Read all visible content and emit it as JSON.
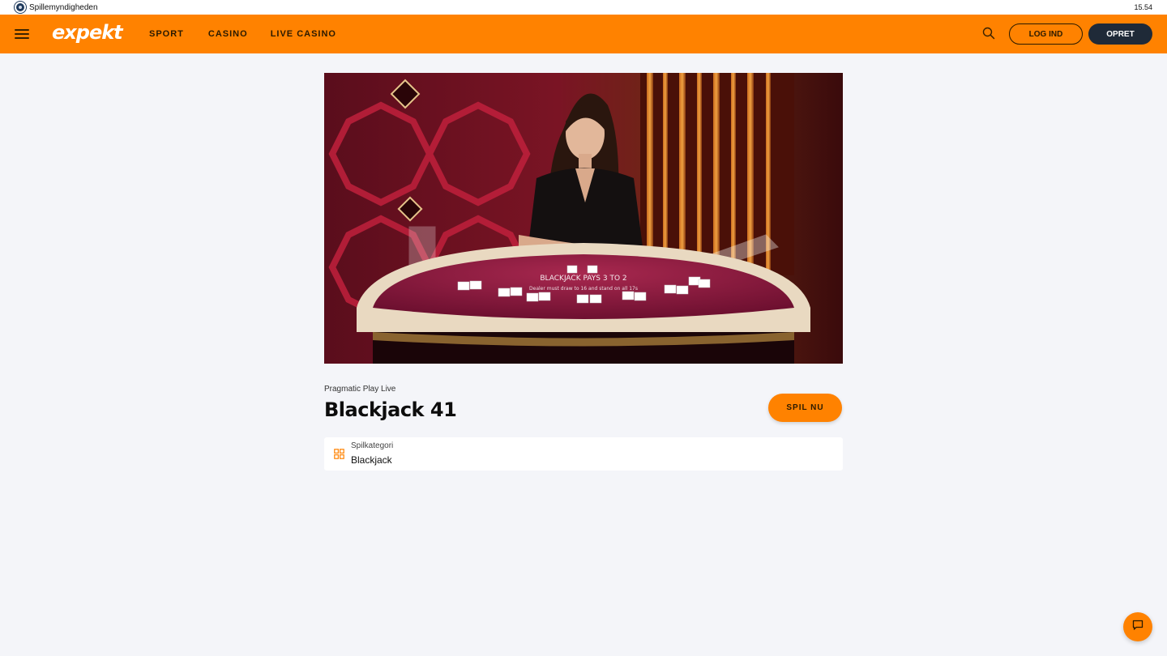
{
  "regulator": {
    "name": "Spillemyndigheden",
    "time": "15.54"
  },
  "header": {
    "logo": "expekt",
    "nav": [
      "SPORT",
      "CASINO",
      "LIVE CASINO"
    ],
    "login_label": "LOG IND",
    "signup_label": "OPRET",
    "brand_color": "#ff8200",
    "icons": {
      "menu": "hamburger-icon",
      "search": "search-icon"
    }
  },
  "game": {
    "provider": "Pragmatic Play Live",
    "title": "Blackjack 41",
    "play_label": "SPIL NU",
    "category_label": "Spilkategori",
    "category_value": "Blackjack",
    "table_print_line1": "BLACKJACK PAYS 3 TO 2",
    "table_print_line2": "Dealer must draw to 16 and stand on all 17s"
  },
  "chat": {
    "icon": "chat-icon"
  }
}
